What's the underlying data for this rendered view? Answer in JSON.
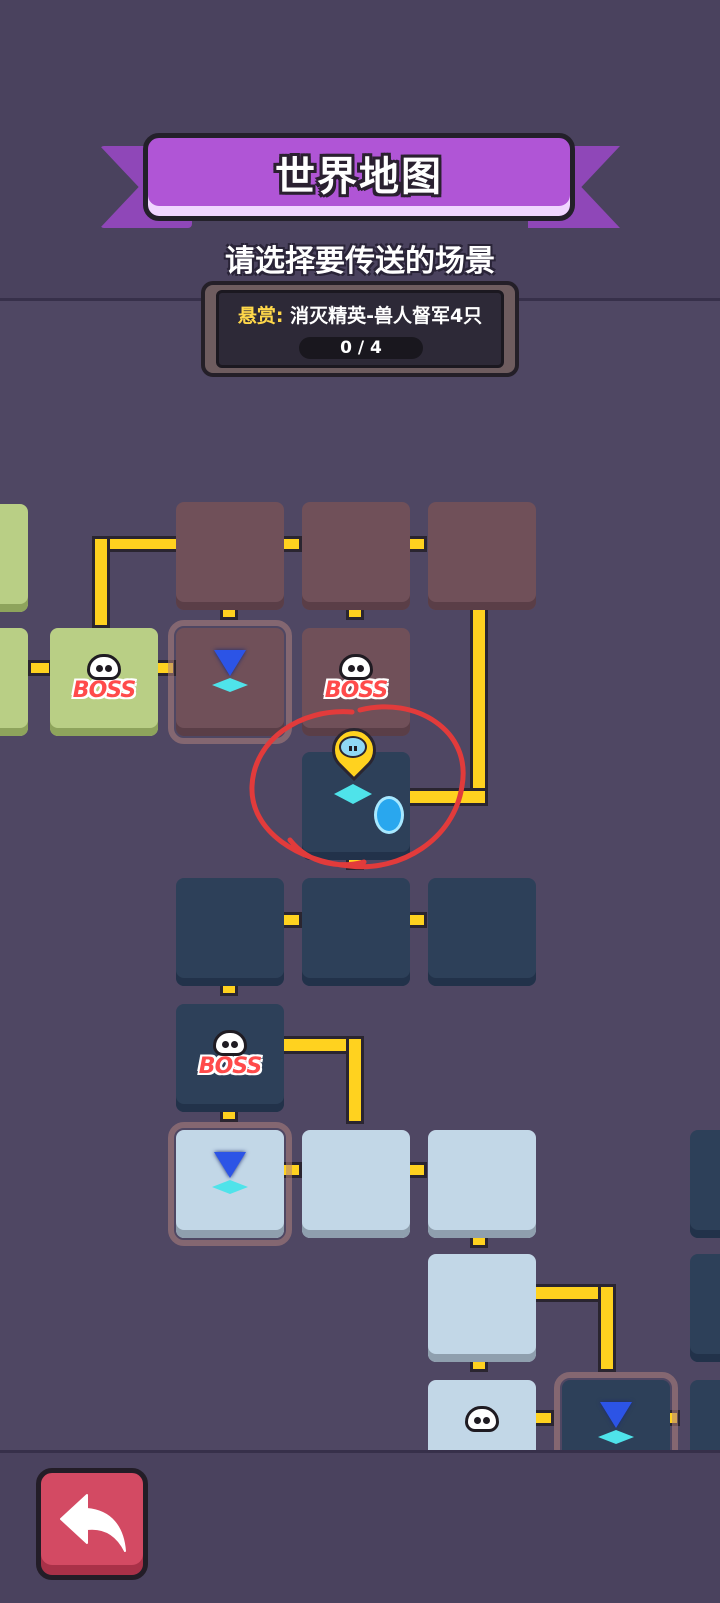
{
  "header": {
    "title": "世界地图",
    "subtitle": "请选择要传送的场景"
  },
  "bounty": {
    "label": "悬赏:",
    "description": "消灭精英-兽人督军4只",
    "progress": "0 / 4"
  },
  "map": {
    "boss_label": "BOSS",
    "tile_colors": {
      "brown": "#705059",
      "navy": "#2d4059",
      "green": "#b9cf85",
      "light": "#c2d7e7"
    },
    "path_color": "#ffd21f",
    "marker_color": "#e23b3b"
  },
  "icons": {
    "back": "back-arrow-icon",
    "portal": "portal-icon",
    "player": "player-location-pin-icon",
    "boss": "skull-icon"
  }
}
